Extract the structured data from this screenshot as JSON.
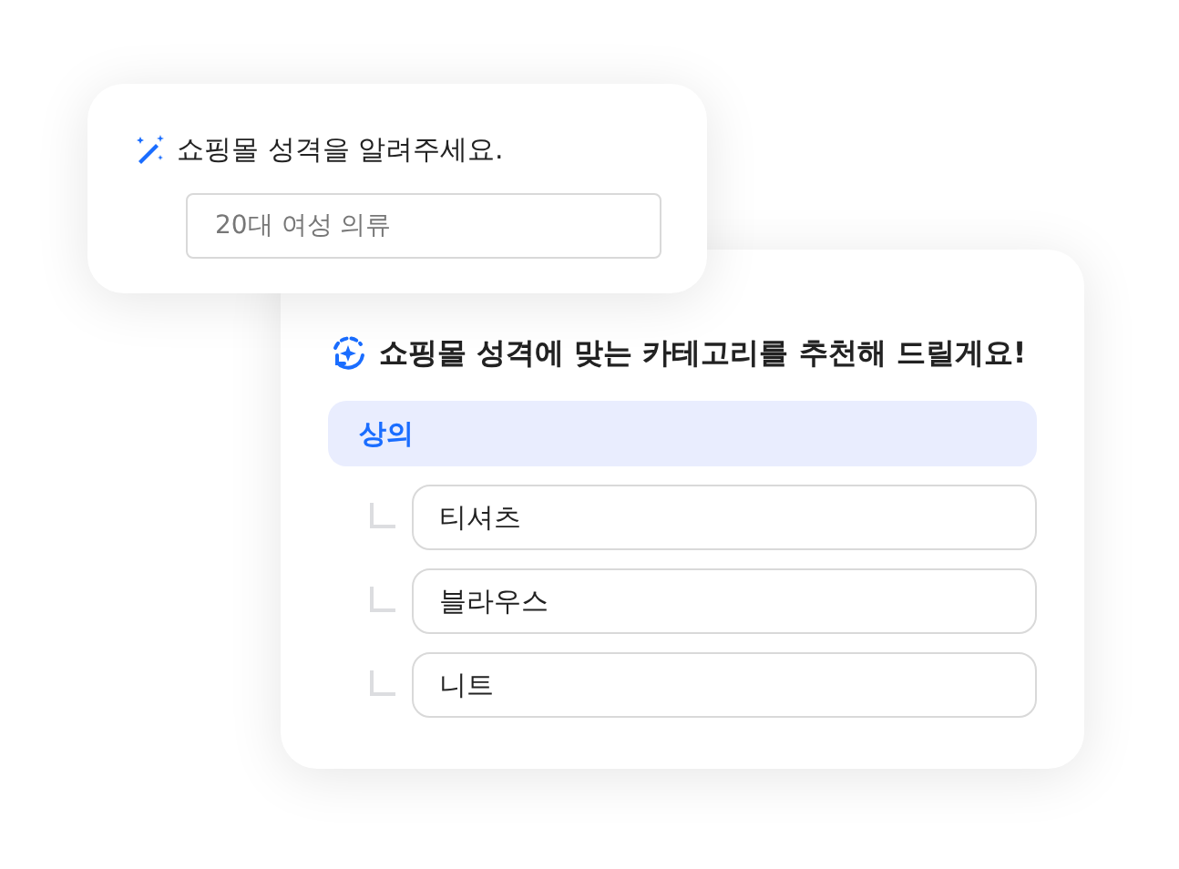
{
  "question_card": {
    "title": "쇼핑몰 성격을 알려주세요.",
    "answer": {
      "value": "20대 여성 의류"
    }
  },
  "recommendation_card": {
    "title": "쇼핑몰 성격에 맞는 카테고리를 추천해 드릴게요!",
    "categories": [
      {
        "label": "상의",
        "children": [
          {
            "label": "티셔츠"
          },
          {
            "label": "블라우스"
          },
          {
            "label": "니트"
          }
        ]
      }
    ]
  }
}
